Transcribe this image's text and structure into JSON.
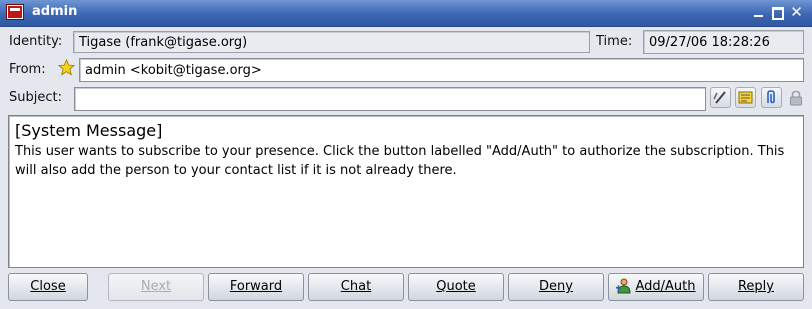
{
  "window": {
    "title": "admin",
    "icon": "app-icon",
    "controls": [
      "minimize-icon",
      "maximize-icon",
      "close-icon"
    ]
  },
  "header": {
    "identity_label": "Identity:",
    "identity_value": "Tigase (frank@tigase.org)",
    "time_label": "Time:",
    "time_value": "09/27/06 18:28:26",
    "from_label": "From:",
    "from_value": "admin <kobit@tigase.org>",
    "from_icon": "star-icon",
    "subject_label": "Subject:",
    "subject_value": "",
    "tools": [
      "spell-check-icon",
      "note-icon",
      "attachment-icon",
      "lock-icon"
    ]
  },
  "message": {
    "header": "[System Message]",
    "body": "This user wants to subscribe to your presence. Click the button labelled \"Add/Auth\" to authorize the subscription. This will also add the person to your contact list if it is not already there."
  },
  "buttons": {
    "close": "Close",
    "next": "Next",
    "forward": "Forward",
    "chat": "Chat",
    "quote": "Quote",
    "deny": "Deny",
    "add_auth": "Add/Auth",
    "reply": "Reply"
  },
  "colors": {
    "titlebar": "#3d66b3",
    "window_bg": "#e4e8ee"
  }
}
